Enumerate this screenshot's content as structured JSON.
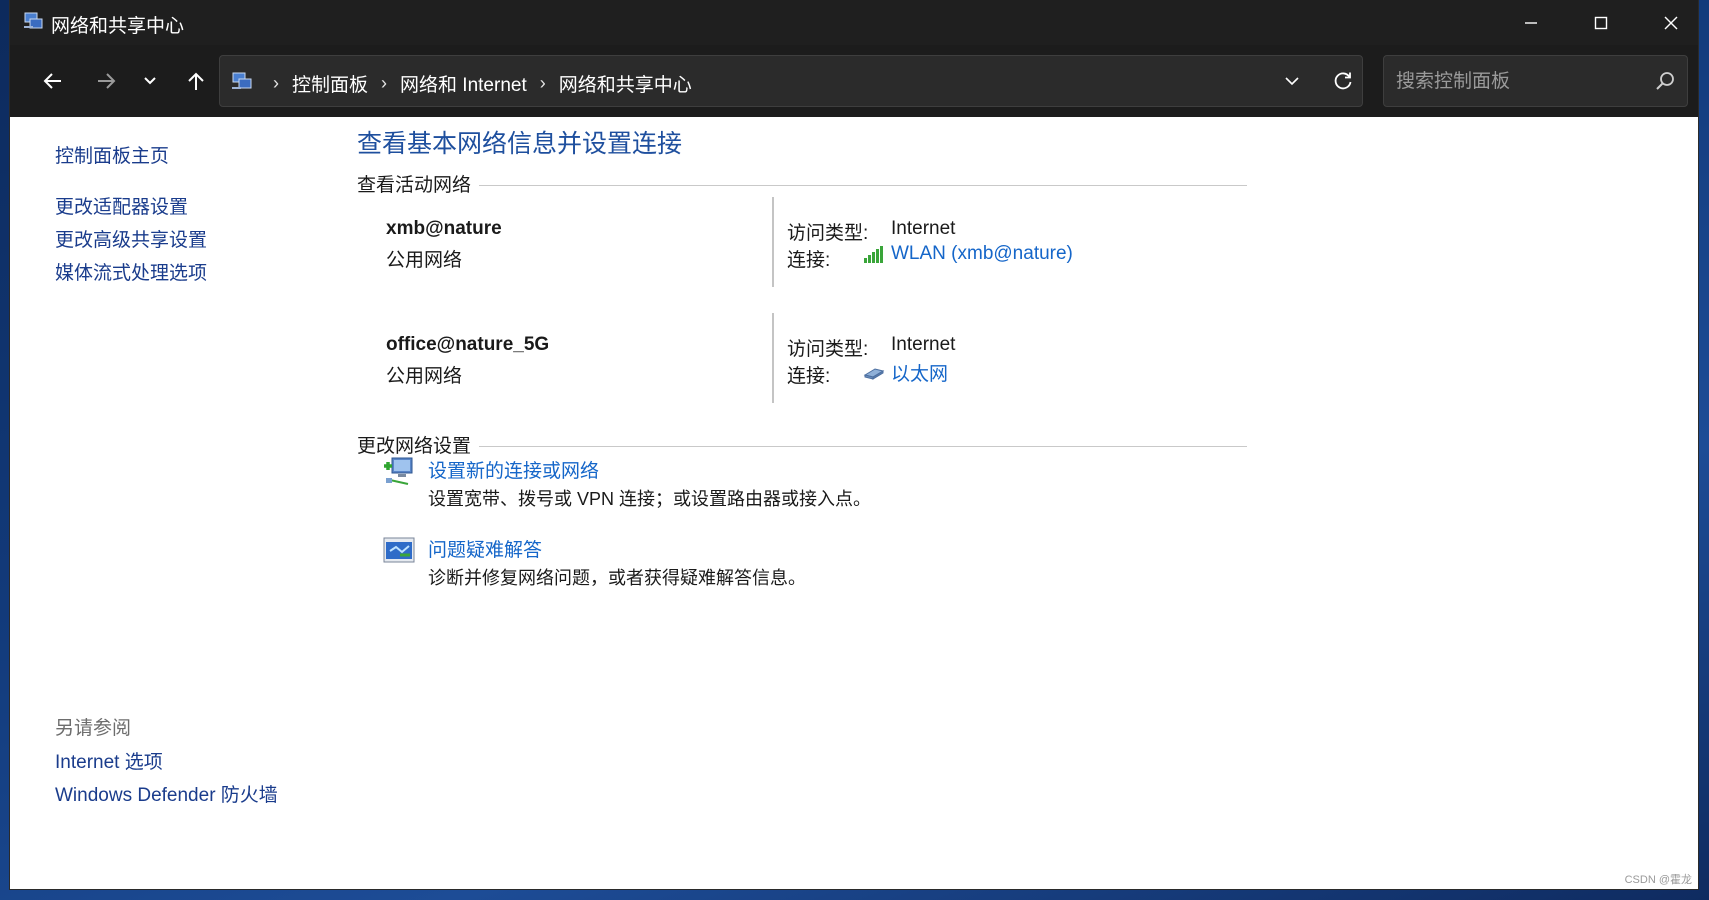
{
  "window": {
    "title": "网络和共享中心"
  },
  "nav": {
    "breadcrumbs": [
      "控制面板",
      "网络和 Internet",
      "网络和共享中心"
    ],
    "search_placeholder": "搜索控制面板"
  },
  "sidebar": {
    "home": "控制面板主页",
    "links": [
      "更改适配器设置",
      "更改高级共享设置",
      "媒体流式处理选项"
    ],
    "see_also_title": "另请参阅",
    "see_also": [
      "Internet 选项",
      "Windows Defender 防火墙"
    ]
  },
  "main": {
    "title": "查看基本网络信息并设置连接",
    "active_networks_heading": "查看活动网络",
    "networks": [
      {
        "name": "xmb@nature",
        "type": "公用网络",
        "access_label": "访问类型:",
        "access_value": "Internet",
        "connection_label": "连接:",
        "connection_value": "WLAN (xmb@nature)",
        "connection_icon": "wifi-signal-icon"
      },
      {
        "name": "office@nature_5G",
        "type": "公用网络",
        "access_label": "访问类型:",
        "access_value": "Internet",
        "connection_label": "连接:",
        "connection_value": "以太网",
        "connection_icon": "ethernet-icon"
      }
    ],
    "change_settings_heading": "更改网络设置",
    "tasks": [
      {
        "link": "设置新的连接或网络",
        "desc": "设置宽带、拨号或 VPN 连接；或设置路由器或接入点。",
        "icon": "new-connection-icon"
      },
      {
        "link": "问题疑难解答",
        "desc": "诊断并修复网络问题，或者获得疑难解答信息。",
        "icon": "troubleshoot-icon"
      }
    ]
  },
  "watermark": "CSDN @霍龙",
  "colors": {
    "link": "#1566c9",
    "title_blue": "#1e4f9e",
    "titlebar": "#1f1f1f",
    "navbar": "#1c1c1c"
  }
}
